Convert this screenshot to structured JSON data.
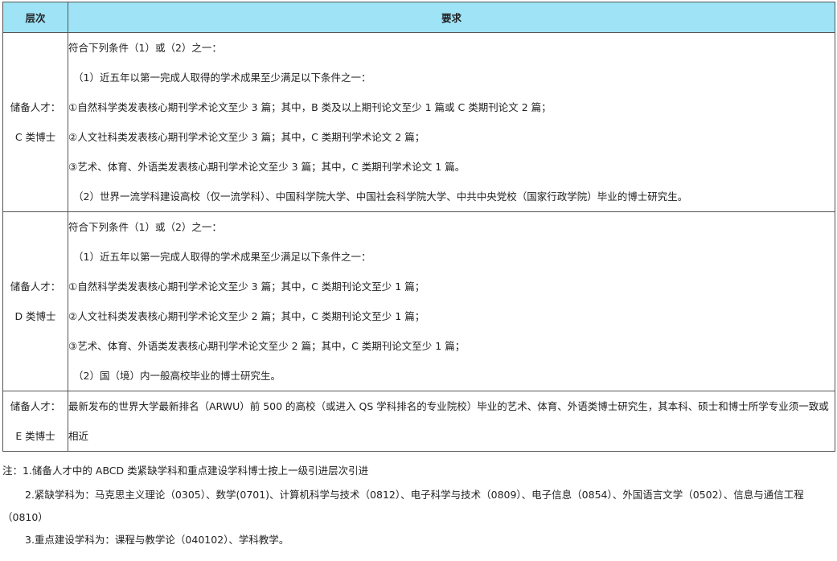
{
  "table": {
    "headers": [
      "层次",
      "要求"
    ],
    "rows": [
      {
        "level": [
          "储备人才：",
          "C 类博士"
        ],
        "lines": [
          "符合下列条件（1）或（2）之一：",
          "（1）近五年以第一完成人取得的学术成果至少满足以下条件之一：",
          "①自然科学类发表核心期刊学术论文至少 3 篇；其中，B 类及以上期刊论文至少 1 篇或 C 类期刊论文 2 篇；",
          "②人文社科类发表核心期刊学术论文至少 3 篇；其中，C 类期刊学术论文 2 篇；",
          "③艺术、体育、外语类发表核心期刊学术论文至少 3 篇；其中，C 类期刊学术论文 1 篇。",
          "（2）世界一流学科建设高校（仅一流学科）、中国科学院大学、中国社会科学院大学、中共中央党校（国家行政学院）毕业的博士研究生。"
        ]
      },
      {
        "level": [
          "储备人才：",
          "D 类博士"
        ],
        "lines": [
          "符合下列条件（1）或（2）之一：",
          "（1）近五年以第一完成人取得的学术成果至少满足以下条件之一：",
          "①自然科学类发表核心期刊学术论文至少 3 篇；其中，C 类期刊论文至少 1 篇；",
          "②人文社科类发表核心期刊学术论文至少 2 篇；其中，C 类期刊论文至少 1 篇；",
          "③艺术、体育、外语类发表核心期刊学术论文至少 2 篇；其中，C 类期刊论文至少 1 篇；",
          "（2）国（境）内一般高校毕业的博士研究生。"
        ]
      },
      {
        "level": [
          "储备人才：",
          "E 类博士"
        ],
        "text": "最新发布的世界大学最新排名（ARWU）前 500 的高校（或进入 QS 学科排名的专业院校）毕业的艺术、体育、外语类博士研究生，其本科、硕士和博士所学专业须一致或相近"
      }
    ]
  },
  "notes": [
    "注：1.储备人才中的 ABCD 类紧缺学科和重点建设学科博士按上一级引进层次引进",
    "2.紧缺学科为：马克思主义理论（0305）、数学(0701)、计算机科学与技术（0812）、电子科学与技术（0809）、电子信息（0854）、外国语言文学（0502）、信息与通信工程（0810）",
    "3.重点建设学科为：课程与教学论（040102）、学科教学。"
  ]
}
